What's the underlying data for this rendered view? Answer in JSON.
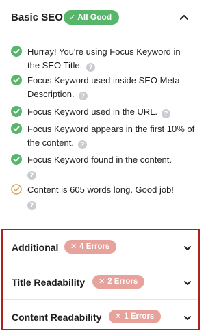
{
  "basic_seo": {
    "title": "Basic SEO",
    "status_label": "All Good",
    "status_color": "#58b66c",
    "checks": [
      {
        "text": "Hurray! You're using Focus Keyword in the SEO Title.",
        "status": "pass"
      },
      {
        "text": "Focus Keyword used inside SEO Meta Description.",
        "status": "pass"
      },
      {
        "text": "Focus Keyword used in the URL.",
        "status": "pass"
      },
      {
        "text": "Focus Keyword appears in the first 10% of the content.",
        "status": "pass"
      },
      {
        "text": "Focus Keyword found in the content.",
        "status": "pass"
      },
      {
        "text": "Content is 605 words long. Good job!",
        "status": "warning"
      }
    ],
    "help_glyph": "?"
  },
  "groups": [
    {
      "title": "Additional",
      "errors_label": "4 Errors"
    },
    {
      "title": "Title Readability",
      "errors_label": "2 Errors"
    },
    {
      "title": "Content Readability",
      "errors_label": "1 Errors"
    }
  ],
  "colors": {
    "pass": "#58b66c",
    "warning": "#d9a55a",
    "error_pill": "#e7a29c",
    "highlight_border": "#a8241d"
  },
  "icons": {
    "pass": "check-circle-icon",
    "warning": "check-circle-outline-icon",
    "help": "help-icon",
    "collapse": "chevron-up-icon",
    "expand": "chevron-down-icon",
    "error": "x-icon"
  }
}
